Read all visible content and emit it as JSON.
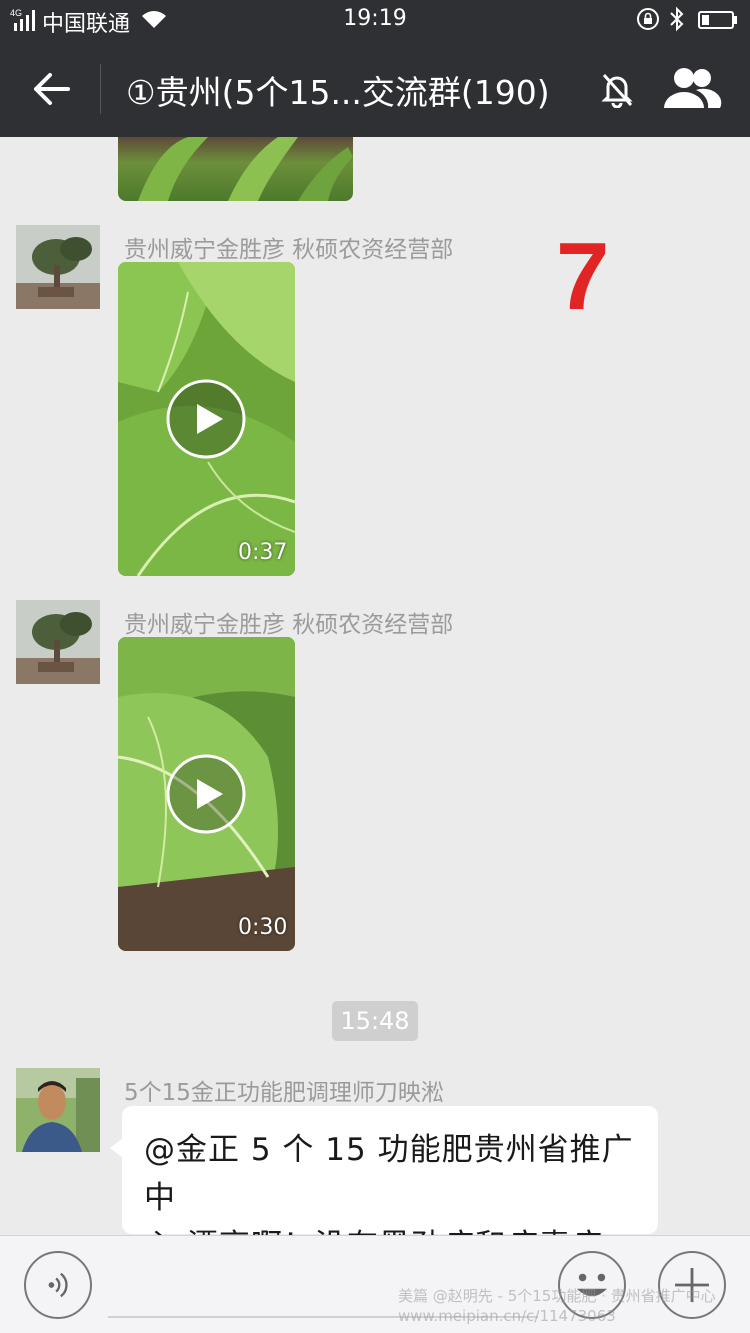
{
  "status_bar": {
    "network": "4G",
    "carrier": "中国联通",
    "time": "19:19"
  },
  "header": {
    "title": "①贵州(5个15...交流群(190)"
  },
  "messages": [
    {
      "sender": "贵州威宁金胜彦   秋硕农资经营部",
      "type": "video",
      "duration": "0:37"
    },
    {
      "sender": "贵州威宁金胜彦   秋硕农资经营部",
      "type": "video",
      "duration": "0:30"
    }
  ],
  "annotation": "7",
  "time_separator": "15:48",
  "text_message": {
    "sender": "5个15金正功能肥调理师刀映淞",
    "line1": "@金正 5 个 15 功能肥贵州省推广中",
    "line2": "心  漂亮啊！没有黑劲病和病毒病"
  },
  "watermark": {
    "line1": "美篇 @赵明先 - 5个15功能肥 · 贵州省推广中心",
    "line2": "www.meipian.cn/c/11473063"
  },
  "colors": {
    "header_bg": "#2f3033",
    "chat_bg": "#ebebeb",
    "annotation": "#e22424"
  }
}
